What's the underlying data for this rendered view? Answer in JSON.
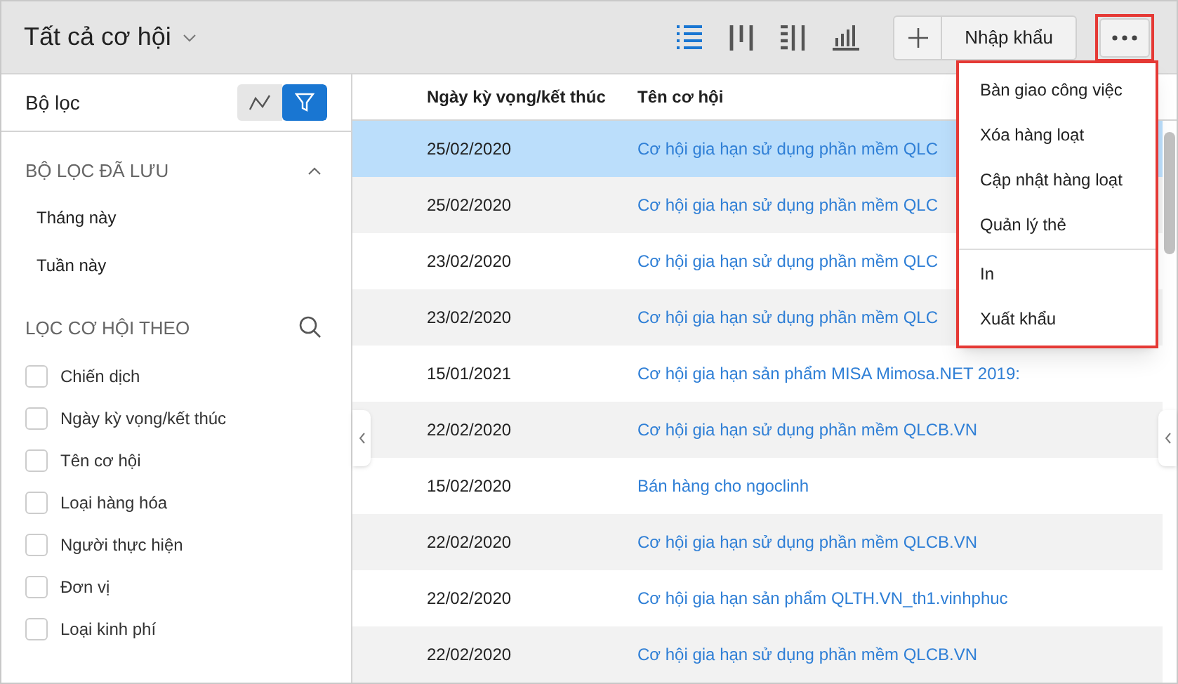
{
  "header": {
    "title": "Tất cả cơ hội",
    "views": [
      {
        "kind": "list",
        "selected": true
      },
      {
        "kind": "kanban",
        "selected": false
      },
      {
        "kind": "split",
        "selected": false
      },
      {
        "kind": "chart",
        "selected": false
      }
    ],
    "import_button": "Nhập khẩu"
  },
  "sidebar": {
    "title": "Bộ lọc",
    "modes": [
      {
        "kind": "trend",
        "selected": false
      },
      {
        "kind": "filter",
        "selected": true
      }
    ],
    "saved_section": {
      "title": "BỘ LỌC ĐÃ LƯU",
      "expanded": true,
      "items": [
        "Tháng này",
        "Tuần này"
      ]
    },
    "filter_section": {
      "title": "LỌC CƠ HỘI THEO",
      "items": [
        {
          "label": "Chiến dịch",
          "checked": false
        },
        {
          "label": "Ngày kỳ vọng/kết thúc",
          "checked": false
        },
        {
          "label": "Tên cơ hội",
          "checked": false
        },
        {
          "label": "Loại hàng hóa",
          "checked": false
        },
        {
          "label": "Người thực hiện",
          "checked": false
        },
        {
          "label": "Đơn vị",
          "checked": false
        },
        {
          "label": "Loại kinh phí",
          "checked": false
        }
      ]
    }
  },
  "table": {
    "columns": [
      "Ngày kỳ vọng/kết thúc",
      "Tên cơ hội"
    ],
    "rows": [
      {
        "date": "25/02/2020",
        "name": "Cơ hội gia hạn sử dụng phần mềm QLC",
        "selected": true
      },
      {
        "date": "25/02/2020",
        "name": "Cơ hội gia hạn sử dụng phần mềm QLC",
        "selected": false
      },
      {
        "date": "23/02/2020",
        "name": "Cơ hội gia hạn sử dụng phần mềm QLC",
        "selected": false
      },
      {
        "date": "23/02/2020",
        "name": "Cơ hội gia hạn sử dụng phần mềm QLC",
        "selected": false
      },
      {
        "date": "15/01/2021",
        "name": "Cơ hội gia hạn sản phẩm MISA Mimosa.NET 2019:",
        "selected": false
      },
      {
        "date": "22/02/2020",
        "name": "Cơ hội gia hạn sử dụng phần mềm QLCB.VN",
        "selected": false
      },
      {
        "date": "15/02/2020",
        "name": "Bán hàng cho ngoclinh",
        "selected": false
      },
      {
        "date": "22/02/2020",
        "name": "Cơ hội gia hạn sử dụng phần mềm QLCB.VN",
        "selected": false
      },
      {
        "date": "22/02/2020",
        "name": "Cơ hội gia hạn sản phẩm QLTH.VN_th1.vinhphuc",
        "selected": false
      },
      {
        "date": "22/02/2020",
        "name": "Cơ hội gia hạn sử dụng phần mềm QLCB.VN",
        "selected": false
      }
    ]
  },
  "more_menu": {
    "open": true,
    "groups": [
      [
        "Bàn giao công việc",
        "Xóa hàng loạt",
        "Cập nhật hàng loạt",
        "Quản lý thẻ"
      ],
      [
        "In",
        "Xuất khẩu"
      ]
    ]
  }
}
